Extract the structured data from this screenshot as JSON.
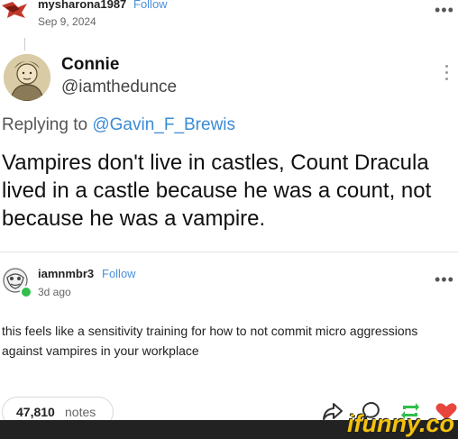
{
  "post": {
    "username": "mysharona1987",
    "follow_label": "Follow",
    "date": "Sep 9, 2024"
  },
  "tweet": {
    "name": "Connie",
    "handle": "@iamthedunce",
    "replying_prefix": "Replying to ",
    "replying_to": "@Gavin_F_Brewis",
    "body": "Vampires don't live in castles, Count Dracula lived in a castle because he was a count, not because he was a vampire."
  },
  "reblog": {
    "username": "iamnmbr3",
    "follow_label": "Follow",
    "date": "3d ago",
    "body": "this feels like a sensitivity training for how to not commit micro aggressions against vampires in your workplace"
  },
  "footer": {
    "notes_count": "47,810",
    "notes_label": "notes",
    "icons": [
      "share-icon",
      "comment-icon",
      "reblog-icon",
      "like-icon"
    ]
  },
  "watermark": {
    "text": "ifunny.co"
  },
  "colors": {
    "link": "#4a90d9",
    "mention": "#3a8ad6",
    "reblog_green": "#2fbf4a",
    "like_red": "#e8453c",
    "watermark_yellow": "#f4c20d"
  }
}
